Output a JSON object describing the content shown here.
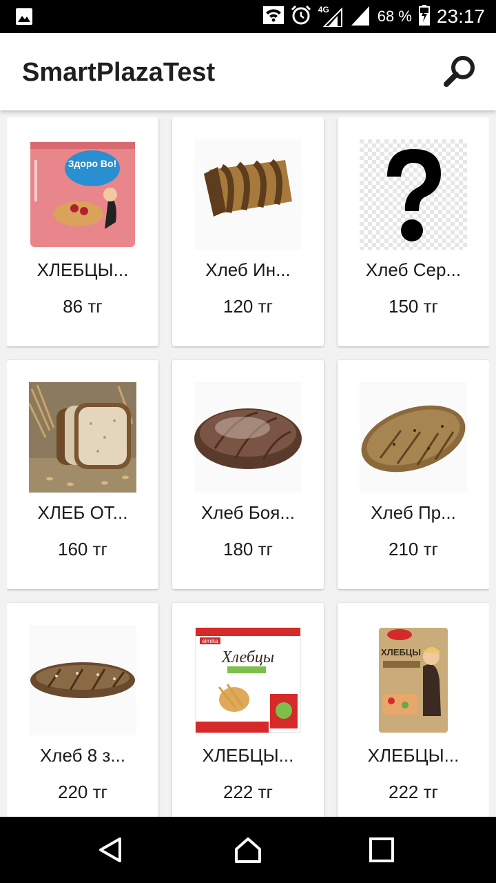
{
  "status_bar": {
    "network_type": "4G",
    "battery_percent": "68 %",
    "time": "23:17",
    "icons": [
      "image-icon",
      "wifi-icon",
      "alarm-icon",
      "signal-icon",
      "battery-icon"
    ]
  },
  "app_bar": {
    "title": "SmartPlazaTest",
    "search_icon": "search-icon"
  },
  "products": [
    {
      "name": "ХЛЕБЦЫ...",
      "price": "86 тг",
      "image": "crispbread-pack-pink"
    },
    {
      "name": "Хлеб Ин...",
      "price": "120 тг",
      "image": "marble-loaf"
    },
    {
      "name": "Хлеб Сер...",
      "price": "150 тг",
      "image": "question-mark-placeholder"
    },
    {
      "name": "ХЛЕБ ОТ...",
      "price": "160 тг",
      "image": "sliced-grain-bread"
    },
    {
      "name": "Хлеб Боя...",
      "price": "180 тг",
      "image": "rye-loaf-dark"
    },
    {
      "name": "Хлеб Пр...",
      "price": "210 тг",
      "image": "seeded-oval-loaf"
    },
    {
      "name": "Хлеб 8 з...",
      "price": "220 тг",
      "image": "eight-grain-baguette"
    },
    {
      "name": "ХЛЕБЦЫ...",
      "price": "222 тг",
      "image": "crispbread-box-elmika"
    },
    {
      "name": "ХЛЕБЦЫ...",
      "price": "222 тг",
      "image": "crispbread-pack-fitness"
    }
  ],
  "pack_texts": {
    "zdorovo": "Здоро Во!",
    "elmika_brand": "elmika",
    "elmika_title": "Хлебцы",
    "fitness_title": "ХЛЕБЦЫ"
  },
  "nav_bar": {
    "icons": [
      "back-icon",
      "home-icon",
      "recents-icon"
    ]
  },
  "colors": {
    "status_bar": "#000000",
    "app_bar": "#ffffff",
    "background": "#f2f2f2",
    "card": "#ffffff",
    "text": "#1a1a1a"
  }
}
